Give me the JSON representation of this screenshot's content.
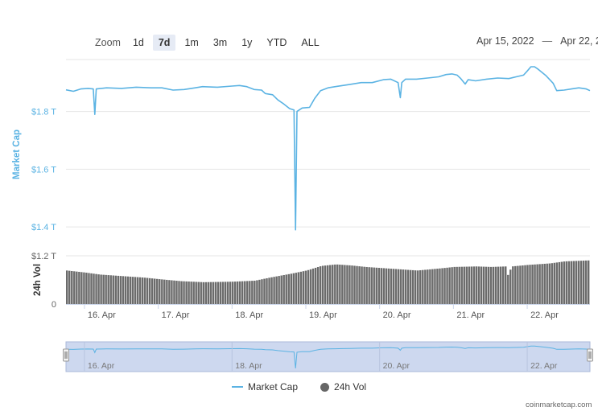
{
  "zoom": {
    "label": "Zoom",
    "buttons": [
      "1d",
      "7d",
      "1m",
      "3m",
      "1y",
      "YTD",
      "ALL"
    ],
    "active": "7d"
  },
  "date_range": {
    "from": "Apr 15, 2022",
    "to": "Apr 22, 2",
    "separator": "—"
  },
  "legend": {
    "market_cap": "Market Cap",
    "volume": "24h Vol"
  },
  "credit": "coinmarketcap.com",
  "colors": {
    "market_cap": "#5bb3e3",
    "volume": "#6b6b6b",
    "navigator_bg": "#cdd8ef",
    "grid": "#e6e6e6"
  },
  "chart_data": [
    {
      "type": "line",
      "ylabel": "Market Cap",
      "y_unit": "T",
      "ylim": [
        1.35,
        1.98
      ],
      "y_ticks": [
        "$1.8 T",
        "$1.6 T",
        "$1.4 T"
      ],
      "y_tick_values": [
        1.8,
        1.6,
        1.4
      ],
      "xlim": [
        15.75,
        22.85
      ],
      "x_ticks": [
        "16. Apr",
        "17. Apr",
        "18. Apr",
        "19. Apr",
        "20. Apr",
        "21. Apr",
        "22. Apr"
      ],
      "x_tick_values": [
        16,
        17,
        18,
        19,
        20,
        21,
        22
      ],
      "x_unit": "day of April 2022",
      "series": [
        {
          "name": "Market Cap",
          "points": [
            [
              15.75,
              1.875
            ],
            [
              15.85,
              1.87
            ],
            [
              15.95,
              1.878
            ],
            [
              16.05,
              1.88
            ],
            [
              16.12,
              1.878
            ],
            [
              16.14,
              1.79
            ],
            [
              16.16,
              1.878
            ],
            [
              16.3,
              1.882
            ],
            [
              16.5,
              1.88
            ],
            [
              16.7,
              1.884
            ],
            [
              16.9,
              1.882
            ],
            [
              17.05,
              1.882
            ],
            [
              17.2,
              1.874
            ],
            [
              17.35,
              1.876
            ],
            [
              17.5,
              1.882
            ],
            [
              17.6,
              1.886
            ],
            [
              17.8,
              1.884
            ],
            [
              18.0,
              1.888
            ],
            [
              18.1,
              1.89
            ],
            [
              18.2,
              1.886
            ],
            [
              18.3,
              1.876
            ],
            [
              18.4,
              1.874
            ],
            [
              18.45,
              1.862
            ],
            [
              18.55,
              1.858
            ],
            [
              18.62,
              1.84
            ],
            [
              18.7,
              1.826
            ],
            [
              18.78,
              1.81
            ],
            [
              18.84,
              1.805
            ],
            [
              18.86,
              1.39
            ],
            [
              18.88,
              1.8
            ],
            [
              18.95,
              1.812
            ],
            [
              19.05,
              1.814
            ],
            [
              19.12,
              1.845
            ],
            [
              19.2,
              1.872
            ],
            [
              19.3,
              1.882
            ],
            [
              19.4,
              1.886
            ],
            [
              19.5,
              1.89
            ],
            [
              19.6,
              1.894
            ],
            [
              19.75,
              1.9
            ],
            [
              19.9,
              1.9
            ],
            [
              20.05,
              1.91
            ],
            [
              20.15,
              1.912
            ],
            [
              20.25,
              1.9
            ],
            [
              20.28,
              1.848
            ],
            [
              20.3,
              1.9
            ],
            [
              20.35,
              1.912
            ],
            [
              20.5,
              1.912
            ],
            [
              20.65,
              1.916
            ],
            [
              20.8,
              1.92
            ],
            [
              20.9,
              1.928
            ],
            [
              20.98,
              1.93
            ],
            [
              21.05,
              1.926
            ],
            [
              21.1,
              1.914
            ],
            [
              21.16,
              1.895
            ],
            [
              21.2,
              1.91
            ],
            [
              21.3,
              1.906
            ],
            [
              21.45,
              1.912
            ],
            [
              21.6,
              1.916
            ],
            [
              21.75,
              1.914
            ],
            [
              21.85,
              1.92
            ],
            [
              21.95,
              1.926
            ],
            [
              22.0,
              1.94
            ],
            [
              22.05,
              1.955
            ],
            [
              22.1,
              1.955
            ],
            [
              22.15,
              1.946
            ],
            [
              22.25,
              1.925
            ],
            [
              22.35,
              1.898
            ],
            [
              22.4,
              1.872
            ],
            [
              22.5,
              1.874
            ],
            [
              22.6,
              1.878
            ],
            [
              22.7,
              1.882
            ],
            [
              22.8,
              1.878
            ],
            [
              22.85,
              1.872
            ]
          ]
        }
      ]
    },
    {
      "type": "bar",
      "ylabel": "24h Vol",
      "y_unit": "T",
      "ylim": [
        0,
        0.95
      ],
      "y_ticks": [
        "$1.2 T",
        "0"
      ],
      "series": [
        {
          "name": "24h Vol",
          "points": [
            [
              15.75,
              0.66
            ],
            [
              16.0,
              0.62
            ],
            [
              16.2,
              0.58
            ],
            [
              16.5,
              0.55
            ],
            [
              16.8,
              0.52
            ],
            [
              17.0,
              0.49
            ],
            [
              17.3,
              0.45
            ],
            [
              17.6,
              0.43
            ],
            [
              18.0,
              0.44
            ],
            [
              18.3,
              0.46
            ],
            [
              18.5,
              0.52
            ],
            [
              18.8,
              0.6
            ],
            [
              19.0,
              0.66
            ],
            [
              19.2,
              0.75
            ],
            [
              19.4,
              0.78
            ],
            [
              19.6,
              0.76
            ],
            [
              19.8,
              0.73
            ],
            [
              20.0,
              0.71
            ],
            [
              20.3,
              0.68
            ],
            [
              20.5,
              0.66
            ],
            [
              20.8,
              0.7
            ],
            [
              21.0,
              0.73
            ],
            [
              21.3,
              0.74
            ],
            [
              21.5,
              0.73
            ],
            [
              21.7,
              0.74
            ],
            [
              21.72,
              0.55
            ],
            [
              21.78,
              0.74
            ],
            [
              22.0,
              0.77
            ],
            [
              22.3,
              0.8
            ],
            [
              22.5,
              0.84
            ],
            [
              22.85,
              0.86
            ]
          ]
        }
      ]
    }
  ]
}
